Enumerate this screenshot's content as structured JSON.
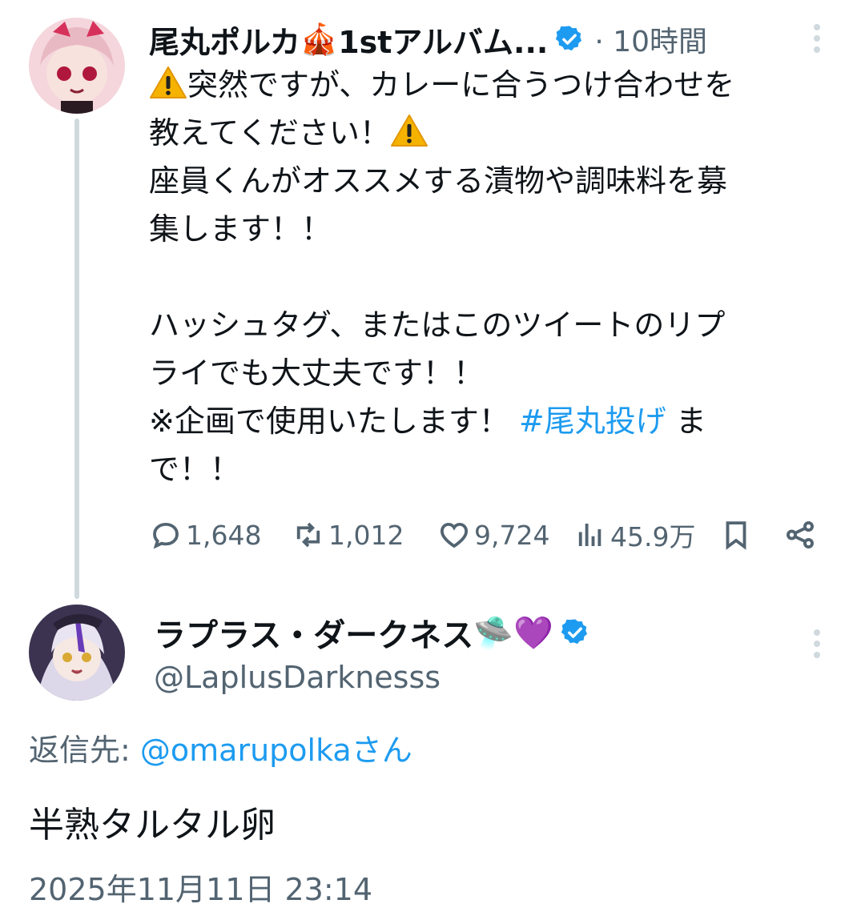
{
  "tweet": {
    "author_name": "尾丸ポルカ",
    "author_name_emoji": "🎪",
    "author_name_suffix": "1stアルバム...",
    "time_ago": "· 10時間",
    "body": {
      "line_1": "突然ですが、カレーに合うつけ合わせを",
      "line_2": "教えてください！",
      "line_3": "座員くんがオススメする漬物や調味料を募",
      "line_4": "集します！！",
      "line_5": "ハッシュタグ、またはこのツイートのリプ",
      "line_6": "ライでも大丈夫です！！",
      "line_7_pre": "※企画で使用いたします！ ",
      "hashtag": "#尾丸投げ",
      "line_7_post": " ま",
      "line_8": "で！！"
    },
    "stats": {
      "replies": "1,648",
      "retweets": "1,012",
      "likes": "9,724",
      "views": "45.9万"
    }
  },
  "reply": {
    "author_name": "ラプラス・ダークネス",
    "author_name_emojis": "🛸💜",
    "handle": "@LaplusDarknesss",
    "reply_to_label": "返信先: ",
    "reply_to_mention": "@omarupolkaさん",
    "body": "半熟タルタル卵",
    "timestamp": "2025年11月11日 23:14"
  },
  "colors": {
    "accent": "#1d9bf0",
    "secondary_text": "#536471",
    "thread_line": "#cfd9de"
  }
}
